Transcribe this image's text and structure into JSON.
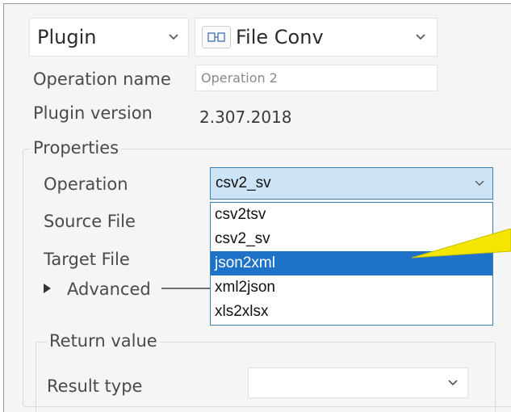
{
  "header": {
    "plugin_selector": "Plugin",
    "file_conv_selector": "File Conv",
    "file_conv_icon": "file-conv-icon"
  },
  "info": {
    "operation_name_label": "Operation name",
    "operation_name_value": "Operation 2",
    "plugin_version_label": "Plugin version",
    "plugin_version_value": "2.307.2018"
  },
  "properties": {
    "title": "Properties",
    "operation_label": "Operation",
    "operation_value": "csv2_sv",
    "source_file_label": "Source File",
    "target_file_label": "Target File",
    "advanced_label": "Advanced",
    "options": [
      "csv2tsv",
      "csv2_sv",
      "json2xml",
      "xml2json",
      "xls2xlsx"
    ],
    "highlighted_option": "json2xml"
  },
  "return_value": {
    "title": "Return value",
    "result_type_label": "Result type",
    "result_type_value": ""
  },
  "colors": {
    "highlight": "#1e73c8",
    "combo_focus": "#cde4f7",
    "callout": "#f5e600"
  }
}
